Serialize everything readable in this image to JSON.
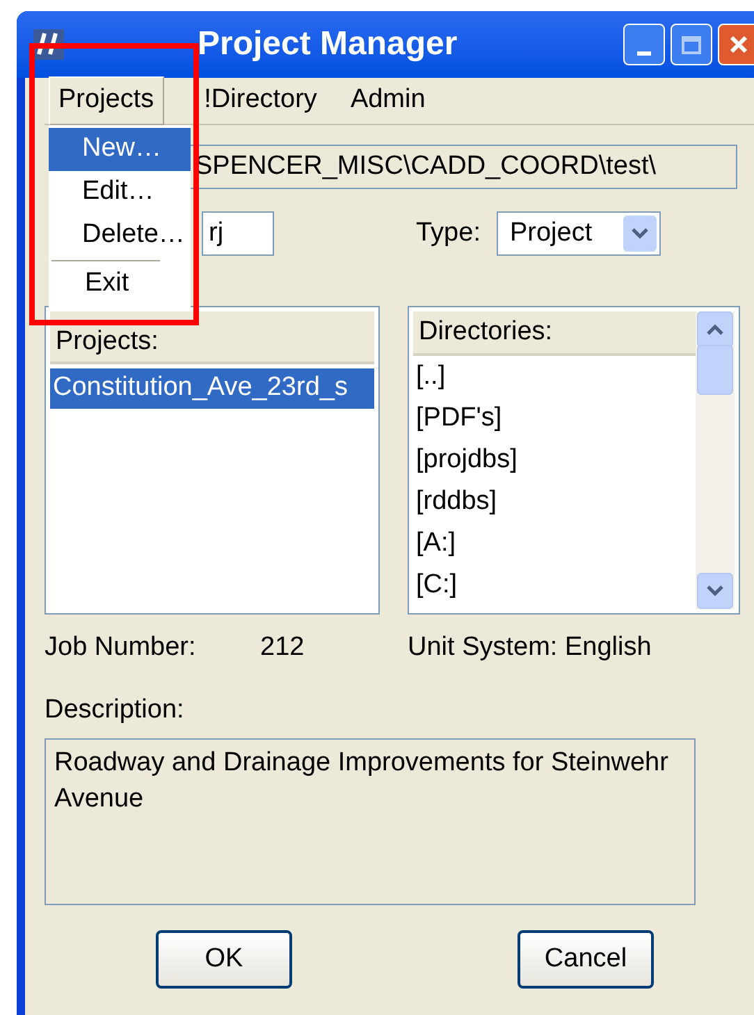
{
  "window": {
    "title": "Project Manager"
  },
  "menu_bar": [
    {
      "label": "Projects",
      "selected": true
    },
    {
      "label": "!Directory",
      "selected": false
    },
    {
      "label": "Admin",
      "selected": false
    }
  ],
  "dropdown": [
    {
      "kind": "item",
      "label": "New…",
      "selected": true
    },
    {
      "kind": "item",
      "label": "Edit…",
      "selected": false
    },
    {
      "kind": "item",
      "label": "Delete…",
      "selected": false
    },
    {
      "kind": "separator"
    },
    {
      "kind": "exit",
      "label": "Exit",
      "selected": false
    }
  ],
  "path_field": {
    "value": "SPENCER_MISC\\CADD_COORD\\test\\"
  },
  "name_field": {
    "value": "rj"
  },
  "type": {
    "label": "Type:",
    "value": "Project"
  },
  "projects": {
    "header": "Projects:",
    "items": [
      {
        "label": "Constitution_Ave_23rd_s",
        "selected": true
      }
    ]
  },
  "directories": {
    "header": "Directories:",
    "items": [
      {
        "label": "[..]",
        "selected": false
      },
      {
        "label": "[PDF's]",
        "selected": false
      },
      {
        "label": "[projdbs]",
        "selected": false
      },
      {
        "label": "[rddbs]",
        "selected": false
      },
      {
        "label": "[A:]",
        "selected": false
      },
      {
        "label": "[C:]",
        "selected": false
      }
    ]
  },
  "job_number": {
    "label": "Job Number:",
    "value": "212"
  },
  "unit_system": "Unit System: English",
  "description": {
    "label": "Description:",
    "value": "Roadway and Drainage Improvements for Steinwehr Avenue"
  },
  "buttons": [
    "OK",
    "Cancel"
  ]
}
